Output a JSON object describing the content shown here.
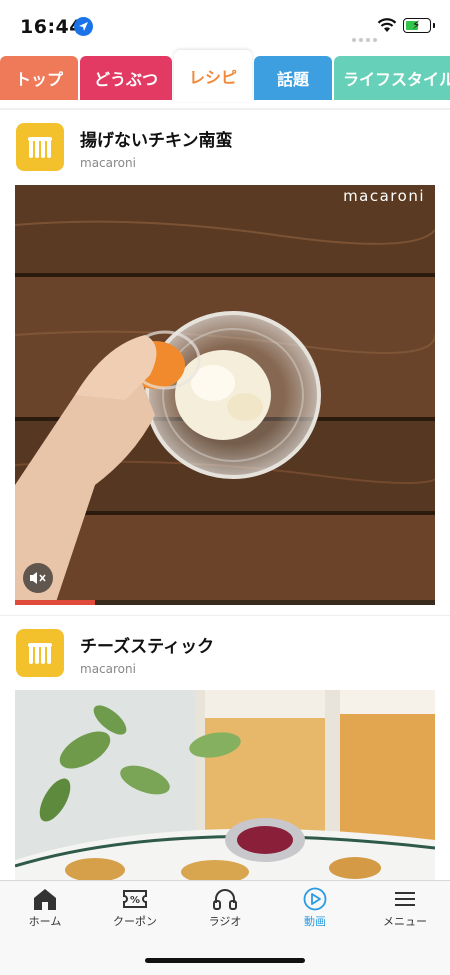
{
  "status_bar": {
    "time": "16:44"
  },
  "tabs": [
    {
      "label": "トップ",
      "color": "#ee7a5a"
    },
    {
      "label": "どうぶつ",
      "color": "#e23a62"
    },
    {
      "label": "レシピ",
      "color": "#f08a3a"
    },
    {
      "label": "話題",
      "color": "#3d9fe0"
    },
    {
      "label": "ライフスタイル",
      "color": "#67d0b8"
    }
  ],
  "articles": [
    {
      "title": "揚げないチキン南蛮",
      "source": "macaroni",
      "watermark": "macaroni"
    },
    {
      "title": "チーズスティック",
      "source": "macaroni"
    }
  ],
  "bottom_nav": {
    "items": [
      {
        "label": "ホーム",
        "icon": "home-icon"
      },
      {
        "label": "クーポン",
        "icon": "coupon-icon"
      },
      {
        "label": "ラジオ",
        "icon": "headphones-icon"
      },
      {
        "label": "動画",
        "icon": "play-circle-icon"
      },
      {
        "label": "メニュー",
        "icon": "hamburger-icon"
      }
    ],
    "active_color": "#2a9be0"
  }
}
